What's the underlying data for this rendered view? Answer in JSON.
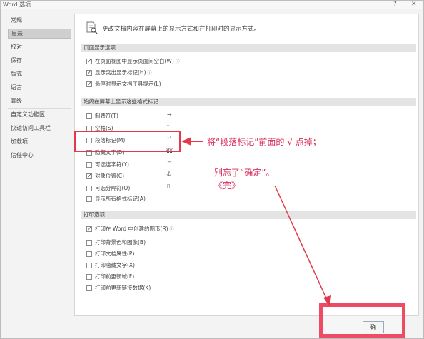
{
  "window": {
    "title": "Word 选项",
    "help": "?",
    "close": "✕"
  },
  "sidebar": {
    "items": [
      {
        "label": "常规"
      },
      {
        "label": "显示",
        "selected": true
      },
      {
        "label": "校对"
      },
      {
        "label": "保存"
      },
      {
        "label": "版式"
      },
      {
        "label": "语言"
      },
      {
        "label": "高级"
      },
      {
        "label": "自定义功能区"
      },
      {
        "label": "快速访问工具栏"
      },
      {
        "label": "加载项"
      },
      {
        "label": "信任中心"
      }
    ]
  },
  "main": {
    "intro": "更改文档内容在屏幕上的显示方式和在打印时的显示方式。",
    "sections": {
      "page_display": {
        "header": "页面显示选项",
        "options": [
          {
            "label": "在页面视图中显示页面间空白(W)",
            "checked": true,
            "info": "ⓘ"
          },
          {
            "label": "显示突出显示标记(H)",
            "checked": true,
            "info": "ⓘ"
          },
          {
            "label": "悬停时显示文档工具提示(L)",
            "checked": true
          }
        ]
      },
      "formatting_marks": {
        "header": "始终在屏幕上显示这些格式标记",
        "options": [
          {
            "label": "制表符(T)",
            "checked": false,
            "symbol": "→"
          },
          {
            "label": "空格(S)",
            "checked": false,
            "symbol": "···"
          },
          {
            "label": "段落标记(M)",
            "checked": false,
            "symbol": "↵"
          },
          {
            "label": "隐藏文字(D)",
            "checked": false,
            "symbol": "abc"
          },
          {
            "label": "可选连字符(Y)",
            "checked": false,
            "symbol": "¬"
          },
          {
            "label": "对象位置(C)",
            "checked": true,
            "symbol": "⚓"
          },
          {
            "label": "可选分隔符(O)",
            "checked": false,
            "symbol": "▯"
          },
          {
            "label": "显示所有格式标记(A)",
            "checked": false
          }
        ]
      },
      "print": {
        "header": "打印选项",
        "options": [
          {
            "label": "打印在 Word 中创建的图形(R)",
            "checked": true,
            "info": "ⓘ"
          },
          {
            "label": "打印背景色和图像(B)",
            "checked": false
          },
          {
            "label": "打印文档属性(P)",
            "checked": false
          },
          {
            "label": "打印隐藏文字(X)",
            "checked": false
          },
          {
            "label": "打印前更新域(F)",
            "checked": false
          },
          {
            "label": "打印前更新链接数据(K)",
            "checked": false
          }
        ]
      }
    }
  },
  "annotations": {
    "instruction": "将“段落标记”前面的 √ 点掉；",
    "reminder": "别忘了“确定”。",
    "end": "《完》",
    "color": "#e23a4a"
  },
  "footer": {
    "ok_label": "确"
  }
}
